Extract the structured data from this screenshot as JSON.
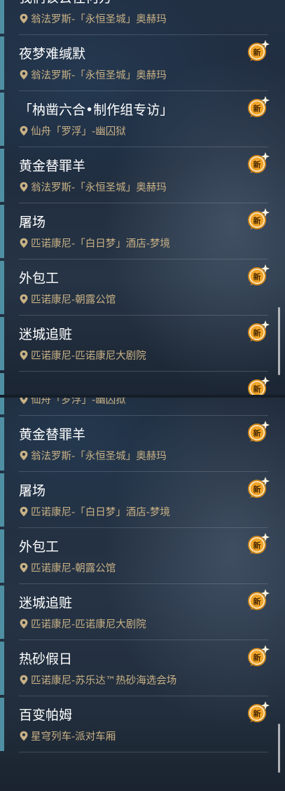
{
  "top_list": [
    {
      "title": "我们该去往何方",
      "location": "翁法罗斯-「永恒圣城」奥赫玛",
      "badge": "",
      "cut": "top"
    },
    {
      "title": "夜梦难缄默",
      "location": "翁法罗斯-「永恒圣城」奥赫玛",
      "badge": "新"
    },
    {
      "title": "「枘凿六合•制作组专访」",
      "location": "仙舟「罗浮」-幽囚狱",
      "badge": "新"
    },
    {
      "title": "黄金替罪羊",
      "location": "翁法罗斯-「永恒圣城」奥赫玛",
      "badge": "新"
    },
    {
      "title": "屠场",
      "location": "匹诺康尼-「白日梦」酒店-梦境",
      "badge": "新"
    },
    {
      "title": "外包工",
      "location": "匹诺康尼-朝露公馆",
      "badge": "新"
    },
    {
      "title": "迷城追赃",
      "location": "匹诺康尼-匹诺康尼大剧院",
      "badge": "新"
    },
    {
      "title": "",
      "location": "",
      "badge": "新",
      "cut": "bottom"
    }
  ],
  "bottom_list": [
    {
      "title": "",
      "location": "仙舟「罗浮」-幽囚狱",
      "badge": "",
      "cut": "top"
    },
    {
      "title": "黄金替罪羊",
      "location": "翁法罗斯-「永恒圣城」奥赫玛",
      "badge": "新"
    },
    {
      "title": "屠场",
      "location": "匹诺康尼-「白日梦」酒店-梦境",
      "badge": "新"
    },
    {
      "title": "外包工",
      "location": "匹诺康尼-朝露公馆",
      "badge": "新"
    },
    {
      "title": "迷城追赃",
      "location": "匹诺康尼-匹诺康尼大剧院",
      "badge": "新"
    },
    {
      "title": "热砂假日",
      "location": "匹诺康尼-苏乐达™热砂海选会场",
      "badge": "新"
    },
    {
      "title": "百变帕姆",
      "location": "星穹列车-派对车厢",
      "badge": "新"
    }
  ],
  "icons": {
    "location": "location-pin-icon",
    "badge": "new-badge-icon"
  },
  "colors": {
    "accent": "#4f8fa3",
    "title": "#ffffff",
    "location": "#c9b185",
    "badge": "#f0a428"
  }
}
